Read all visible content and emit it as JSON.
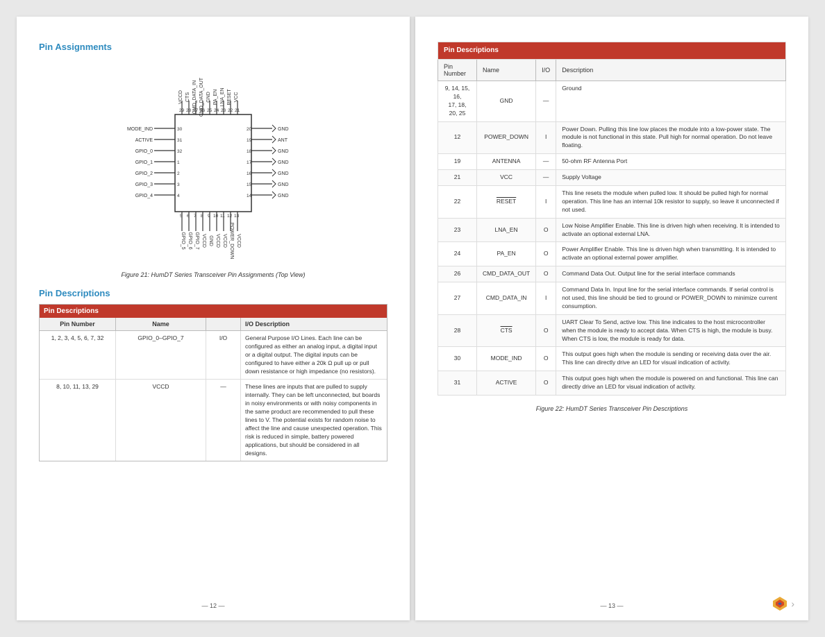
{
  "left_page": {
    "pin_assignments_title": "Pin Assignments",
    "figure_caption": "Figure 21: HumDT Series Transceiver Pin Assignments (Top View)",
    "pin_descriptions_title": "Pin Descriptions",
    "table_header": "Pin Descriptions",
    "col_headers": [
      "Pin Number",
      "Name",
      "I/O Description"
    ],
    "rows": [
      {
        "pin": "1, 2, 3, 4, 5, 6, 7, 32",
        "name": "GPIO_0–GPIO_7",
        "io": "I/O",
        "desc": "General Purpose I/O Lines. Each line can be configured as either an analog input, a digital input or a digital output. The digital inputs can be configured to have either a 20k Ω pull up or pull down resistance or high impedance (no resistors)."
      },
      {
        "pin": "8, 10, 11, 13, 29",
        "name": "VCCD",
        "io": "—",
        "desc": "These lines are inputs that are pulled to supply internally. They can be left unconnected, but boards in noisy environments or with noisy components in the same product are recommended to pull these lines to V. The potential exists for random noise to affect the line and cause unexpected operation. This risk is reduced in simple, battery powered applications, but should be considered in all designs."
      }
    ],
    "page_number": "— 12 —"
  },
  "right_page": {
    "table_header": "Pin Descriptions",
    "col_headers": [
      "Pin Number",
      "Name",
      "I/O",
      "Description"
    ],
    "rows": [
      {
        "pin": "9, 14, 15, 16, 17, 18, 20, 25",
        "name": "GND",
        "io": "—",
        "desc": "Ground"
      },
      {
        "pin": "12",
        "name": "POWER_DOWN",
        "io": "I",
        "desc": "Power Down. Pulling this line low places the module into a low-power state. The module is not functional in this state. Pull high for normal operation. Do not leave floating."
      },
      {
        "pin": "19",
        "name": "ANTENNA",
        "io": "—",
        "desc": "50-ohm RF Antenna Port"
      },
      {
        "pin": "21",
        "name": "VCC",
        "io": "—",
        "desc": "Supply Voltage"
      },
      {
        "pin": "22",
        "name": "RESET",
        "io": "I",
        "desc": "This line resets the module when pulled low. It should be pulled high for normal operation. This line has an internal 10k resistor to supply, so leave it unconnected if not used.",
        "overline": true
      },
      {
        "pin": "23",
        "name": "LNA_EN",
        "io": "O",
        "desc": "Low Noise Amplifier Enable. This line is driven high when receiving. It is intended to activate an optional external LNA."
      },
      {
        "pin": "24",
        "name": "PA_EN",
        "io": "O",
        "desc": "Power Amplifier Enable. This line is driven high when transmitting. It is intended to activate an optional external power amplifier."
      },
      {
        "pin": "26",
        "name": "CMD_DATA_OUT",
        "io": "O",
        "desc": "Command Data Out. Output line for the serial interface commands"
      },
      {
        "pin": "27",
        "name": "CMD_DATA_IN",
        "io": "I",
        "desc": "Command Data In. Input line for the serial interface commands. If serial control is not used, this line should be tied to ground or POWER_DOWN to minimize current consumption."
      },
      {
        "pin": "28",
        "name": "CTS",
        "io": "O",
        "desc": "UART Clear To Send, active low. This line indicates to the host microcontroller when the module is ready to accept data. When CTS is high, the module is busy. When CTS is low, the module is ready for data.",
        "overline": true
      },
      {
        "pin": "30",
        "name": "MODE_IND",
        "io": "O",
        "desc": "This output goes high when the module is sending or receiving data over the air. This line can directly drive an LED for visual indication of activity."
      },
      {
        "pin": "31",
        "name": "ACTIVE",
        "io": "O",
        "desc": "This output goes high when the module is powered on and functional. This line can directly drive an LED for visual indication of activity."
      }
    ],
    "figure_caption": "Figure 22: HumDT Series Transceiver Pin Descriptions",
    "page_number": "— 13 —"
  }
}
